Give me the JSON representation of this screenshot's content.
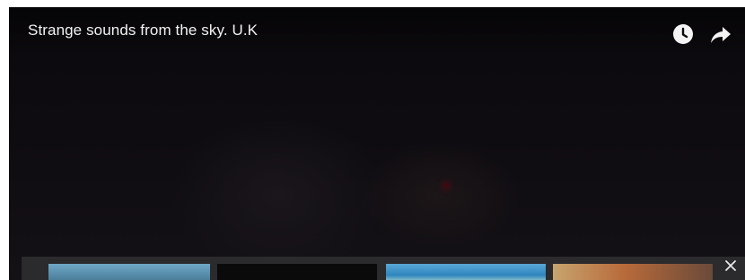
{
  "video": {
    "title": "Strange sounds from the sky. U.K"
  },
  "controls": {
    "watch_later_icon": "clock-icon",
    "share_icon": "share-arrow-icon",
    "close_icon": "close-icon"
  },
  "related_videos": [
    {
      "thumbnail": "video-thumbnail-1"
    },
    {
      "thumbnail": "video-thumbnail-2"
    },
    {
      "thumbnail": "video-thumbnail-3"
    },
    {
      "thumbnail": "video-thumbnail-4"
    }
  ],
  "colors": {
    "background": "#0c0a0e",
    "title_text": "#f2f2f2",
    "endscreen_strip": "#2b2a2d"
  }
}
